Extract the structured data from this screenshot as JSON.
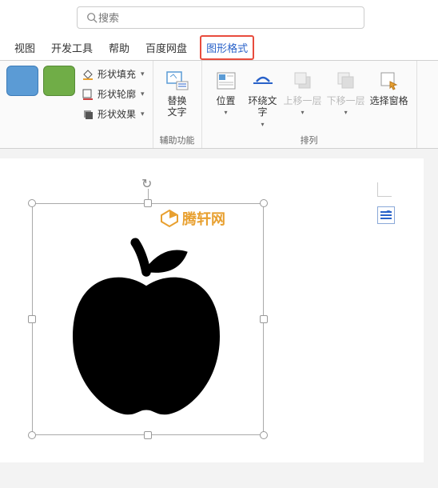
{
  "search": {
    "placeholder": "搜索"
  },
  "tabs": [
    {
      "label": "视图"
    },
    {
      "label": "开发工具"
    },
    {
      "label": "帮助"
    },
    {
      "label": "百度网盘"
    },
    {
      "label": "图形格式",
      "active": true
    }
  ],
  "ribbon": {
    "shape_fill": "形状填充",
    "shape_outline": "形状轮廓",
    "shape_effects": "形状效果",
    "alt_text": {
      "label": "替换\n文字",
      "group": "辅助功能"
    },
    "position": "位置",
    "wrap_text": "环绕文\n字",
    "bring_forward": "上移一层",
    "send_backward": "下移一层",
    "selection_pane": "选择窗格",
    "arrange_group": "排列"
  },
  "watermark": "腾轩网"
}
